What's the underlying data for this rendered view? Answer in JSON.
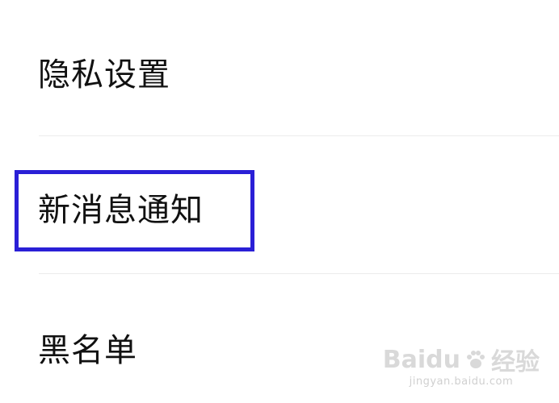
{
  "settings": {
    "items": [
      {
        "label": "隐私设置"
      },
      {
        "label": "新消息通知"
      },
      {
        "label": "黑名单"
      }
    ]
  },
  "highlight": {
    "color": "#2a1fd6"
  },
  "watermark": {
    "brand": "Baidu",
    "brand_suffix": "经验",
    "url": "jingyan.baidu.com"
  }
}
